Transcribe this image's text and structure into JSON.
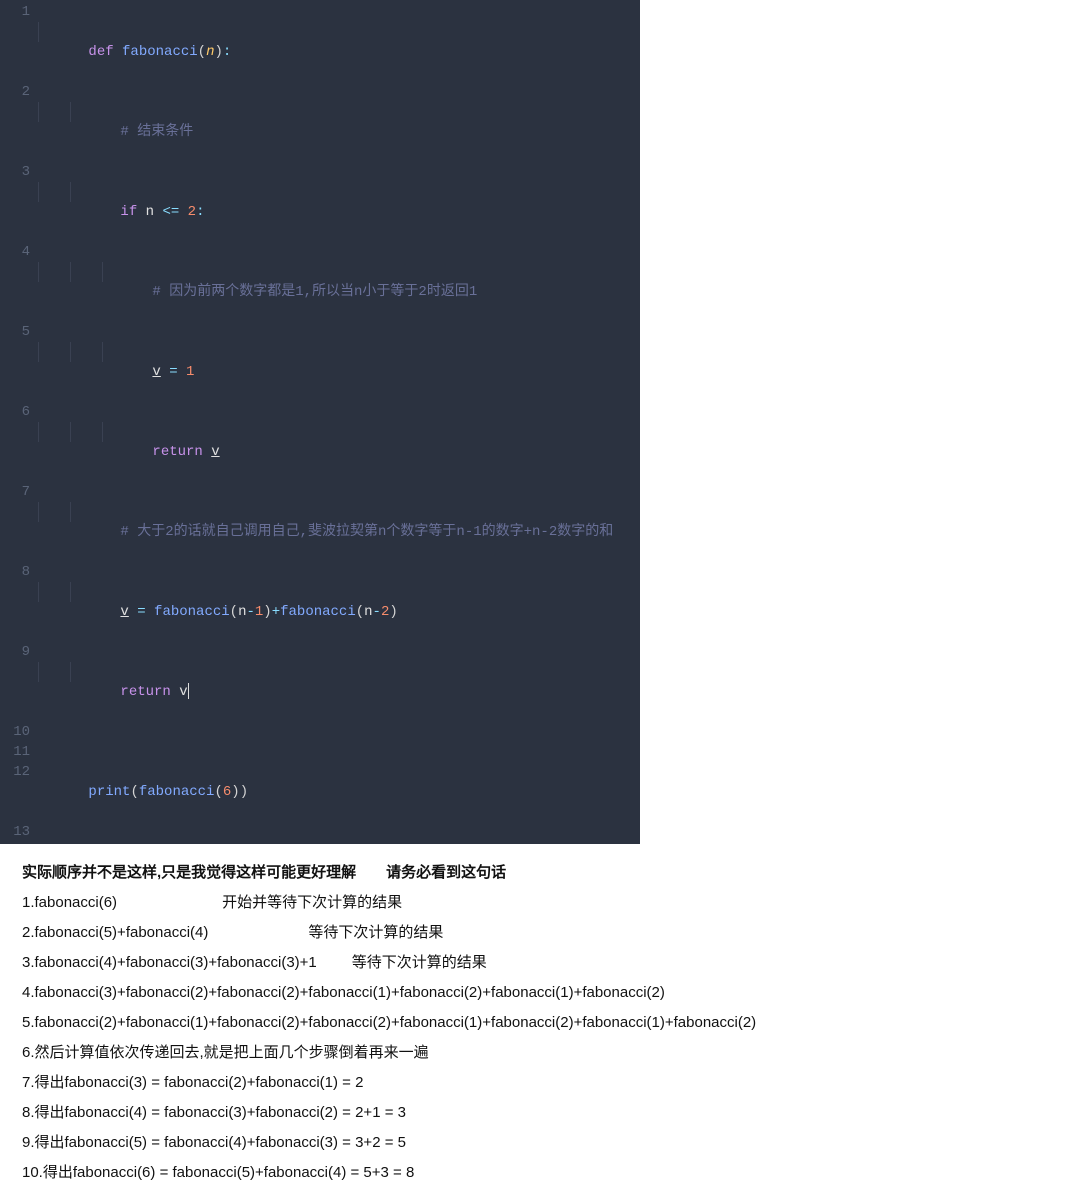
{
  "code": {
    "line1": {
      "num": "1",
      "kw_def": "def ",
      "fn": "fabonacci",
      "lp": "(",
      "param": "n",
      "rp": ")",
      "colon": ":"
    },
    "line2": {
      "num": "2",
      "cmt": "# 结束条件"
    },
    "line3": {
      "num": "3",
      "kw_if": "if ",
      "var": "n",
      "op": " <= ",
      "val": "2",
      "colon": ":"
    },
    "line4": {
      "num": "4",
      "cmt": "# 因为前两个数字都是1,所以当n小于等于2时返回1"
    },
    "line5": {
      "num": "5",
      "var": "v",
      "op": " = ",
      "val": "1"
    },
    "line6": {
      "num": "6",
      "kw": "return ",
      "var": "v"
    },
    "line7": {
      "num": "7",
      "cmt": "# 大于2的话就自己调用自己,斐波拉契第n个数字等于n-1的数字+n-2数字的和"
    },
    "line8": {
      "num": "8",
      "var": "v",
      "op": " = ",
      "fn1": "fabonacci",
      "lp1": "(",
      "arg1a": "n",
      "m1": "-",
      "arg1b": "1",
      "rp1": ")",
      "plus": "+",
      "fn2": "fabonacci",
      "lp2": "(",
      "arg2a": "n",
      "m2": "-",
      "arg2b": "2",
      "rp2": ")"
    },
    "line9": {
      "num": "9",
      "kw": "return ",
      "var": "v"
    },
    "line10": {
      "num": "10"
    },
    "line11": {
      "num": "11"
    },
    "line12": {
      "num": "12",
      "fn1": "print",
      "lp1": "(",
      "fn2": "fabonacci",
      "lp2": "(",
      "arg": "6",
      "rp2": ")",
      "rp1": ")"
    },
    "line13": {
      "num": "13"
    }
  },
  "explain": {
    "title_a": "实际顺序并不是这样,只是我觉得这样可能更好理解",
    "title_b": "请务必看到这句话",
    "l1a": "1.fabonacci(6)",
    "l1b": "开始并等待下次计算的结果",
    "l2a": "2.fabonacci(5)+fabonacci(4)",
    "l2b": "等待下次计算的结果",
    "l3a": "3.fabonacci(4)+fabonacci(3)+fabonacci(3)+1",
    "l3b": "等待下次计算的结果",
    "l4": "4.fabonacci(3)+fabonacci(2)+fabonacci(2)+fabonacci(1)+fabonacci(2)+fabonacci(1)+fabonacci(2)",
    "l5": "5.fabonacci(2)+fabonacci(1)+fabonacci(2)+fabonacci(2)+fabonacci(1)+fabonacci(2)+fabonacci(1)+fabonacci(2)",
    "l6": "6.然后计算值依次传递回去,就是把上面几个步骤倒着再来一遍",
    "l7": "7.得出fabonacci(3) = fabonacci(2)+fabonacci(1) = 2",
    "l8": "8.得出fabonacci(4) = fabonacci(3)+fabonacci(2) = 2+1 = 3",
    "l9": "9.得出fabonacci(5) = fabonacci(4)+fabonacci(3) = 3+2 = 5",
    "l10": "10.得出fabonacci(6) =  fabonacci(5)+fabonacci(4) = 5+3 = 8"
  }
}
